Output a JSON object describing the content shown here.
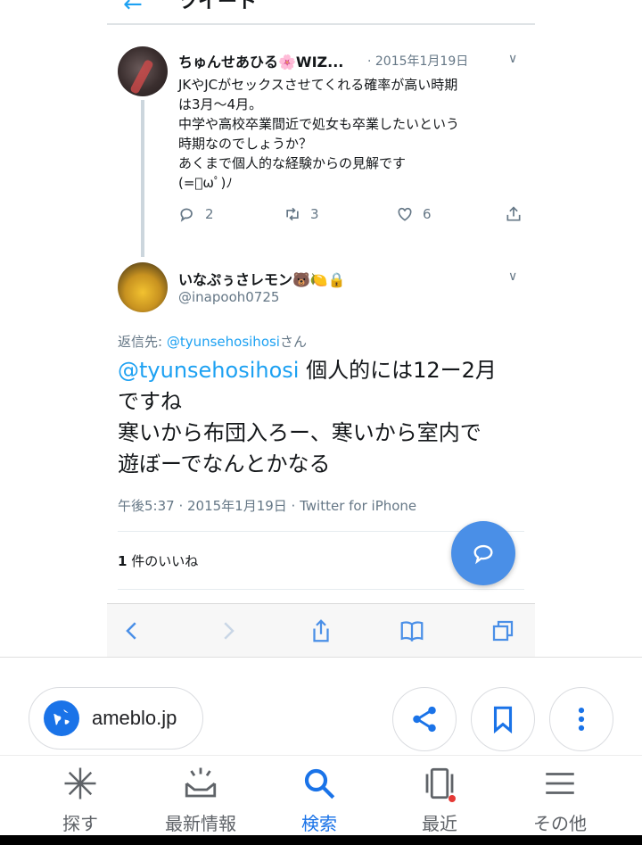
{
  "twitter": {
    "header_title": "ツイート",
    "tweet1": {
      "name": "ちゅんせあひる🌸WIZ...",
      "date": "· 2015年1月19日",
      "lines": [
        "JKやJCがセックスさせてくれる確率が高い時期",
        "は3月～4月。",
        "中学や高校卒業間近で処女も卒業したいという",
        "時期なのでしょうか？",
        "あくまで個人的な経験からの見解です",
        "(=ﾟωﾟ)ﾉ"
      ],
      "replies": "2",
      "retweets": "3",
      "likes": "6"
    },
    "tweet2": {
      "name": "いなぷぅさレモン🐻🍋🔒",
      "handle": "@inapooh0725",
      "reply_prefix": "返信先: ",
      "reply_handle": "@tyunsehosihosi",
      "reply_suffix": "さん",
      "mention": "@tyunsehosihosi",
      "line1_rest": " 個人的には12ー2月",
      "line2": "ですね",
      "line3": "寒いから布団入ろー、寒いから室内で",
      "line4": "遊ぼーでなんとかなる",
      "meta": "午後5:37 · 2015年1月19日 · Twitter for iPhone",
      "likes_count": "1",
      "likes_label": " 件のいいね"
    }
  },
  "browser": {
    "url": "ameblo.jp"
  },
  "bottom_nav": [
    {
      "label": "探す",
      "icon": "sparkle-icon"
    },
    {
      "label": "最新情報",
      "icon": "inbox-icon"
    },
    {
      "label": "検索",
      "icon": "search-icon"
    },
    {
      "label": "最近",
      "icon": "recent-tabs-icon"
    },
    {
      "label": "その他",
      "icon": "menu-icon"
    }
  ],
  "colors": {
    "twitter_blue": "#1da1f2",
    "google_blue": "#1a73e8",
    "fab_blue": "#4a8fe7"
  }
}
